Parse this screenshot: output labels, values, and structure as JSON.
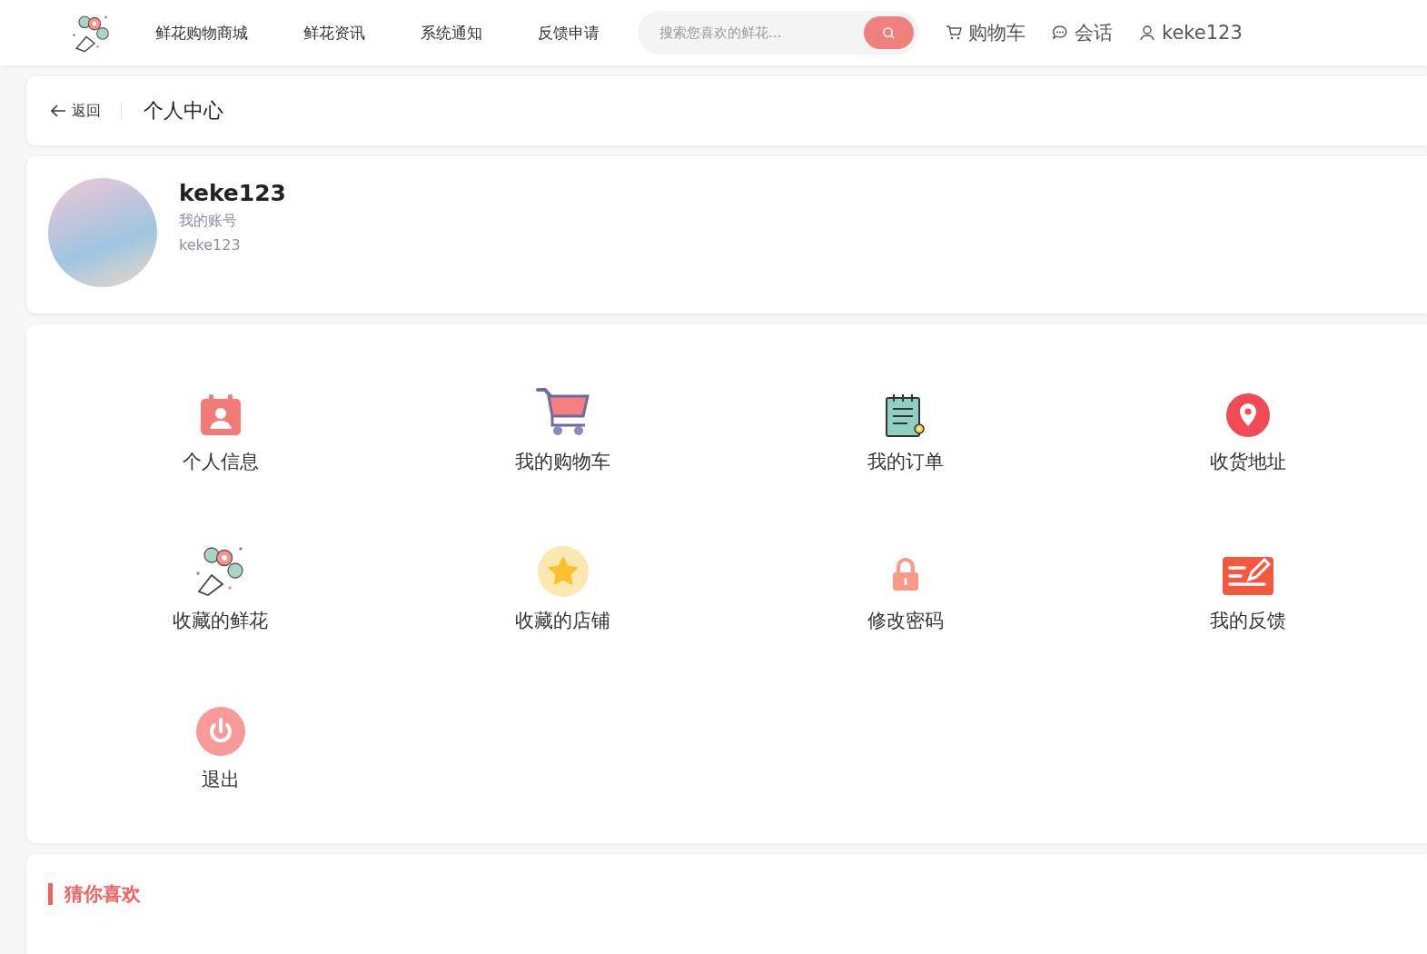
{
  "nav": {
    "links": [
      {
        "label": "鲜花购物商城"
      },
      {
        "label": "鲜花资讯"
      },
      {
        "label": "系统通知"
      },
      {
        "label": "反馈申请"
      }
    ],
    "search": {
      "placeholder": "搜索您喜欢的鲜花..."
    },
    "actions": [
      {
        "kind": "cart",
        "label": "购物车"
      },
      {
        "kind": "chat",
        "label": "会话"
      },
      {
        "kind": "user",
        "label": "keke123"
      }
    ]
  },
  "breadcrumb": {
    "back": "返回",
    "title": "个人中心"
  },
  "profile": {
    "name": "keke123",
    "account_label": "我的账号",
    "account": "keke123"
  },
  "menu": [
    {
      "label": "个人信息"
    },
    {
      "label": "我的购物车"
    },
    {
      "label": "我的订单"
    },
    {
      "label": "收货地址"
    },
    {
      "label": "收藏的鲜花"
    },
    {
      "label": "收藏的店铺"
    },
    {
      "label": "修改密码"
    },
    {
      "label": "我的反馈"
    },
    {
      "label": "退出"
    }
  ],
  "recommend": {
    "title": "猜你喜欢"
  }
}
